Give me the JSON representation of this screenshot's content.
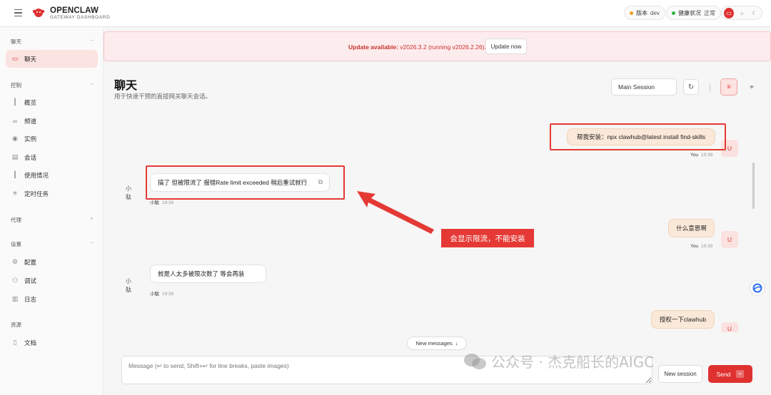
{
  "app": {
    "brand": "OPENCLAW",
    "subtitle": "GATEWAY DASHBOARD"
  },
  "topbar": {
    "version_label": "版本",
    "version_value": "dev",
    "health_label": "健康状况",
    "health_value": "正常",
    "accent": "#e03131",
    "version_dot": "#f0a020",
    "health_dot": "#2fb344"
  },
  "sidebar": {
    "sections": [
      {
        "label": "聊天",
        "caret": "−",
        "items": [
          {
            "label": "聊天",
            "icon": "chat-icon",
            "glyph": "▭",
            "active": true
          }
        ]
      },
      {
        "label": "控制",
        "caret": "−",
        "items": [
          {
            "label": "概览",
            "icon": "bar-chart-icon",
            "glyph": "┃"
          },
          {
            "label": "频道",
            "icon": "link-icon",
            "glyph": "∞"
          },
          {
            "label": "实例",
            "icon": "radio-icon",
            "glyph": "◉"
          },
          {
            "label": "会话",
            "icon": "document-icon",
            "glyph": "▤"
          },
          {
            "label": "使用情况",
            "icon": "bar-chart-icon",
            "glyph": "┃"
          },
          {
            "label": "定时任务",
            "icon": "loader-icon",
            "glyph": "✳"
          }
        ]
      },
      {
        "label": "代理",
        "caret": "+",
        "items": []
      },
      {
        "label": "设置",
        "caret": "−",
        "items": [
          {
            "label": "配置",
            "icon": "gear-icon",
            "glyph": "⚙"
          },
          {
            "label": "调试",
            "icon": "bug-icon",
            "glyph": "⚇"
          },
          {
            "label": "日志",
            "icon": "scroll-icon",
            "glyph": "▥"
          }
        ]
      },
      {
        "label": "资源",
        "caret": "",
        "items": [
          {
            "label": "文档",
            "icon": "book-icon",
            "glyph": "▯"
          }
        ]
      }
    ]
  },
  "banner": {
    "prefix": "Update available:",
    "text": " v2026.3.2 (running v2026.2.26).",
    "button": "Update now"
  },
  "page": {
    "title": "聊天",
    "subtitle": "用于快速干预的直接网关聊天会话。"
  },
  "toolbar": {
    "session": "Main Session"
  },
  "messages": {
    "m1": {
      "text": "帮我安装：npx clawhub@latest install find-skills",
      "sender": "You",
      "time": "19:38",
      "avatar": "U"
    },
    "m2": {
      "text": "搞了 但被限流了 报错Rate limit exceeded 稍后重试就行",
      "sender": "小駄",
      "time": "19:39",
      "avatar_alt": "小\n駄"
    },
    "m3": {
      "text": "什么意思啊",
      "sender": "You",
      "time": "19:39",
      "avatar": "U"
    },
    "m4": {
      "text": "就是人太多被限次数了 等会再装",
      "sender": "小駄",
      "time": "19:39",
      "avatar_alt": "小\n駄"
    },
    "m5": {
      "text": "授权一下clawhub",
      "avatar": "U"
    }
  },
  "annotation": {
    "callout": "会显示限流，不能安装"
  },
  "new_messages": "New messages",
  "composer": {
    "placeholder": "Message (↩ to send, Shift+↩ for line breaks, paste images)",
    "new_session": "New session",
    "send": "Send"
  },
  "watermark": "公众号 · 杰克船长的AIGC"
}
